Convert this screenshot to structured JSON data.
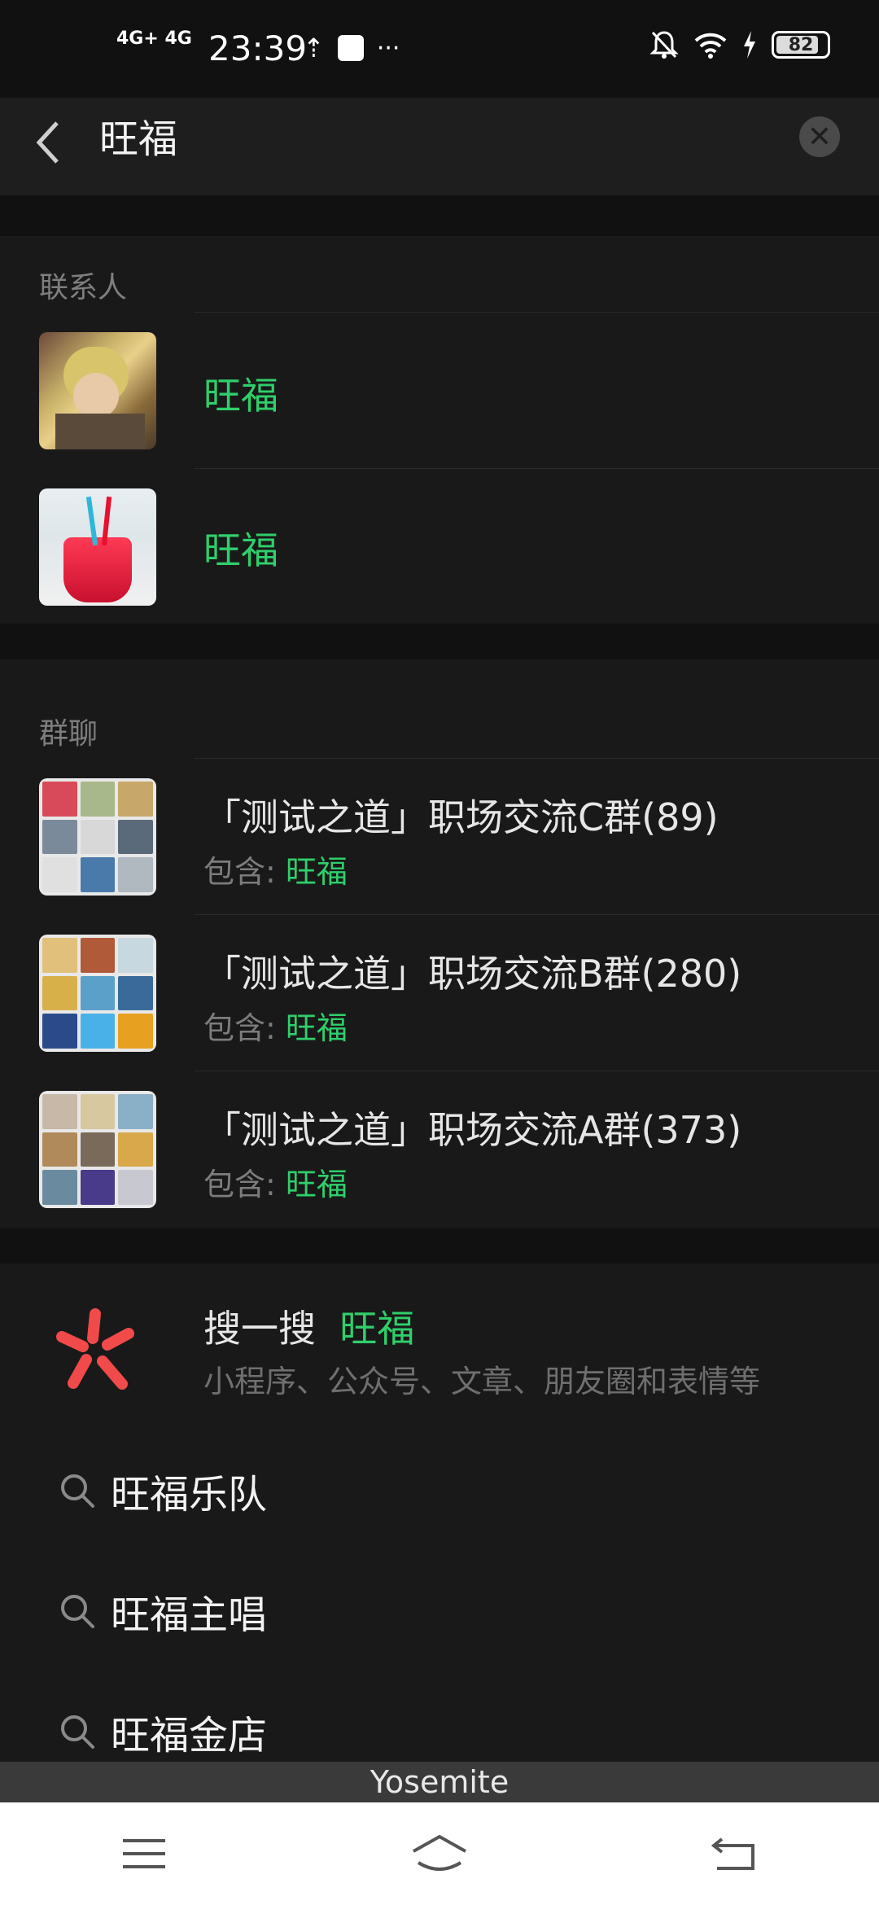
{
  "status_bar": {
    "network": "4G+",
    "network2": "4G",
    "time": "23:39",
    "more": "···",
    "battery": "82"
  },
  "header": {
    "query": "旺福"
  },
  "contacts": {
    "title": "联系人",
    "items": [
      {
        "name": "旺福"
      },
      {
        "name": "旺福"
      }
    ]
  },
  "groups": {
    "title": "群聊",
    "items": [
      {
        "title": "「测试之道」职场交流C群(89)",
        "sub_label": "包含: ",
        "sub_match": "旺福"
      },
      {
        "title": "「测试之道」职场交流B群(280)",
        "sub_label": "包含: ",
        "sub_match": "旺福"
      },
      {
        "title": "「测试之道」职场交流A群(373)",
        "sub_label": "包含: ",
        "sub_match": "旺福"
      }
    ]
  },
  "search_one": {
    "label": "搜一搜",
    "query": "旺福",
    "sub": "小程序、公众号、文章、朋友圈和表情等"
  },
  "suggestions": [
    "旺福乐队",
    "旺福主唱",
    "旺福金店"
  ],
  "bottom_label": "Yosemite",
  "colors": {
    "accent": "#2fcf6b",
    "background": "#111111",
    "section": "#191919"
  }
}
